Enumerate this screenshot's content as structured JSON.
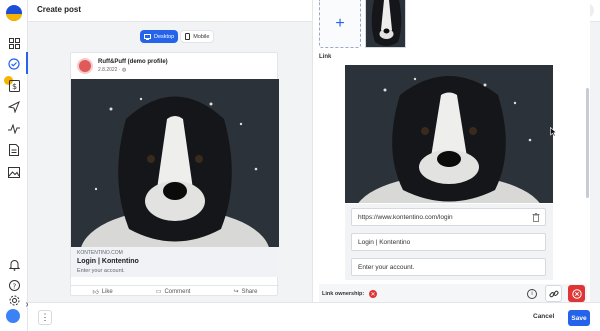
{
  "header": {
    "title": "Create post"
  },
  "preview": {
    "tabs": [
      {
        "label": "Desktop",
        "active": true
      },
      {
        "label": "Mobile",
        "active": false
      }
    ],
    "post": {
      "page_name": "Ruff&Puff (demo profile)",
      "date": "2.8.2022 · ",
      "link_domain": "KONTENTINO.COM",
      "link_title": "Login | Kontentino",
      "link_description": "Enter your account.",
      "actions": [
        {
          "label": "Like",
          "icon": "thumbs-up-icon"
        },
        {
          "label": "Comment",
          "icon": "comment-icon"
        },
        {
          "label": "Share",
          "icon": "share-icon"
        }
      ]
    }
  },
  "editor": {
    "link_section_label": "Link",
    "url": "https://www.kontentino.com/login",
    "title": "Login | Kontentino",
    "description": "Enter your account.",
    "ownership_label": "Link ownership:"
  },
  "footer": {
    "cancel_label": "Cancel",
    "save_label": "Save"
  },
  "colors": {
    "accent": "#2563eb",
    "danger": "#e03535",
    "brand_yellow": "#f4b400"
  }
}
